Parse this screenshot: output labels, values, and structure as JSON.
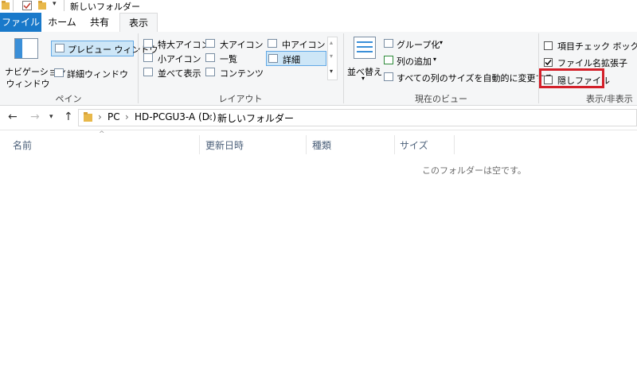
{
  "window": {
    "title": "新しいフォルダー"
  },
  "tabs": [
    {
      "label": "ファイル"
    },
    {
      "label": "ホーム"
    },
    {
      "label": "共有"
    },
    {
      "label": "表示"
    }
  ],
  "ribbon": {
    "pane": {
      "label": "ペイン",
      "navigation_pane_line1": "ナビゲーション",
      "navigation_pane_line2": "ウィンドウ",
      "preview_pane": "プレビュー ウィンドウ",
      "details_pane": "詳細ウィンドウ"
    },
    "layout": {
      "label": "レイアウト",
      "items": [
        "特大アイコン",
        "大アイコン",
        "中アイコン",
        "小アイコン",
        "一覧",
        "詳細",
        "並べて表示",
        "コンテンツ"
      ],
      "selected": "詳細"
    },
    "current_view": {
      "label": "現在のビュー",
      "sort_by": "並べ替え",
      "group_by": "グループ化",
      "add_columns": "列の追加",
      "size_all_columns": "すべての列のサイズを自動的に変更する"
    },
    "show_hide": {
      "label": "表示/非表示",
      "item_check_boxes": {
        "label": "項目チェック ボックス",
        "checked": false
      },
      "file_name_extensions": {
        "label": "ファイル名拡張子",
        "checked": true
      },
      "hidden_items": {
        "label": "隠しファイル",
        "checked": false
      }
    }
  },
  "address": {
    "crumbs": [
      "PC",
      "HD-PCGU3-A (D:)",
      "新しいフォルダー"
    ]
  },
  "columns": [
    "名前",
    "更新日時",
    "種類",
    "サイズ"
  ],
  "empty_message": "このフォルダーは空です。",
  "colors": {
    "accent": "#1979ca",
    "highlight": "#d3202a",
    "selected": "#cde6f7"
  }
}
